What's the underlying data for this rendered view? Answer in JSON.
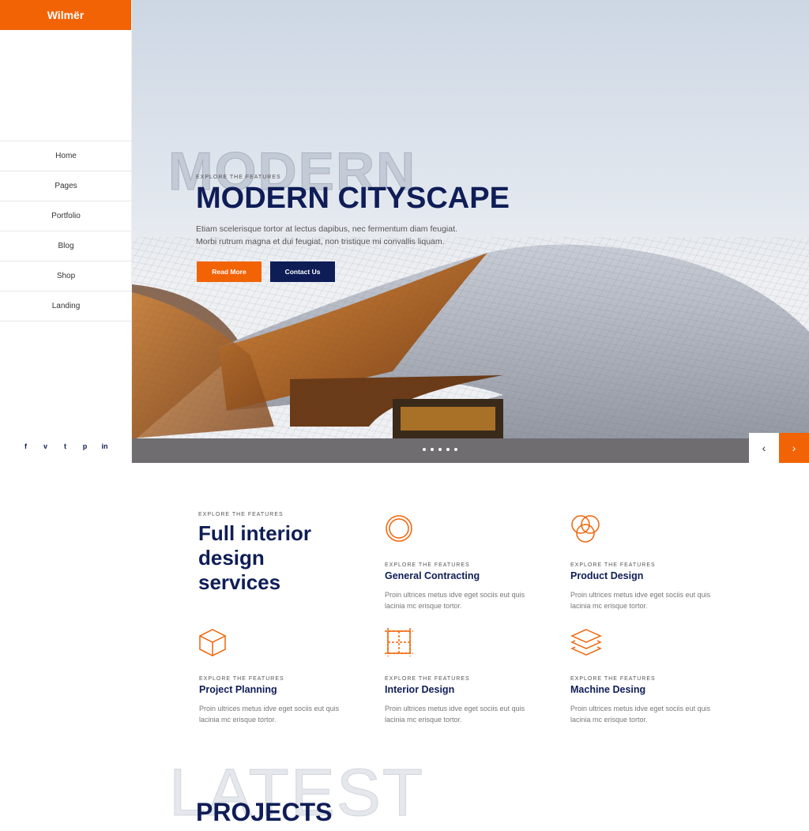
{
  "brand": "Wilmër",
  "nav": [
    "Home",
    "Pages",
    "Portfolio",
    "Blog",
    "Shop",
    "Landing"
  ],
  "social": [
    "f",
    "v",
    "t",
    "p",
    "in"
  ],
  "hero": {
    "ghost": "MODERN",
    "eyebrow": "EXPLORE THE FEATURES",
    "title": "MODERN CITYSCAPE",
    "text1": "Etiam scelerisque tortor at lectus dapibus, nec fermentum diam feugiat.",
    "text2": "Morbi rutrum magna et dui feugiat, non tristique mi convallis liquam.",
    "read_more": "Read More",
    "contact": "Contact Us",
    "prev": "‹",
    "next": "›"
  },
  "services": {
    "eyebrow": "EXPLORE THE FEATURES",
    "title": "Full interior design services",
    "items": [
      {
        "eyebrow": "EXPLORE THE FEATURES",
        "title": "General Contracting",
        "text": "Proin ultrices metus idve eget sociis eut quis lacinia mc erisque tortor."
      },
      {
        "eyebrow": "EXPLORE THE FEATURES",
        "title": "Product Design",
        "text": "Proin ultrices metus idve eget sociis eut quis lacinia mc erisque tortor."
      },
      {
        "eyebrow": "EXPLORE THE FEATURES",
        "title": "Project Planning",
        "text": "Proin ultrices metus idve eget sociis eut quis lacinia mc erisque tortor."
      },
      {
        "eyebrow": "EXPLORE THE FEATURES",
        "title": "Interior Design",
        "text": "Proin ultrices metus idve eget sociis eut quis lacinia mc erisque tortor."
      },
      {
        "eyebrow": "EXPLORE THE FEATURES",
        "title": "Machine Desing",
        "text": "Proin ultrices metus idve eget sociis eut quis lacinia mc erisque tortor."
      }
    ]
  },
  "latest": {
    "ghost": "LATEST",
    "title": "PROJECTS"
  },
  "colors": {
    "accent": "#f26306",
    "navy": "#0f1d57"
  }
}
